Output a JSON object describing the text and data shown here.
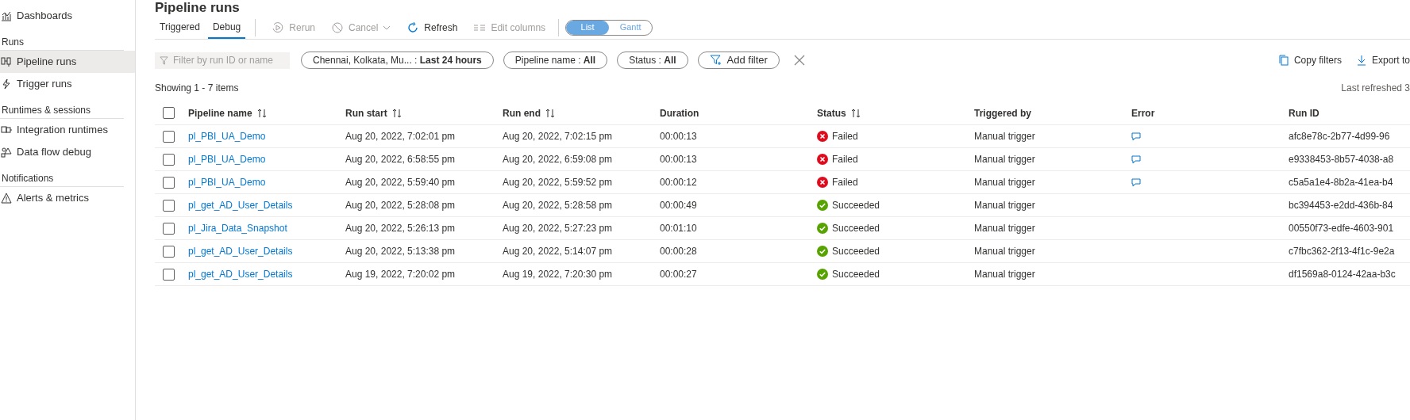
{
  "sidebar": {
    "sections": [
      {
        "items": [
          {
            "label": "Dashboards",
            "selected": false
          }
        ]
      },
      {
        "header": "Runs",
        "items": [
          {
            "label": "Pipeline runs",
            "selected": true
          },
          {
            "label": "Trigger runs",
            "selected": false
          }
        ]
      },
      {
        "header": "Runtimes & sessions",
        "items": [
          {
            "label": "Integration runtimes",
            "selected": false
          },
          {
            "label": "Data flow debug",
            "selected": false
          }
        ]
      },
      {
        "header": "Notifications",
        "items": [
          {
            "label": "Alerts & metrics",
            "selected": false
          }
        ]
      }
    ]
  },
  "page_title": "Pipeline runs",
  "tabs": [
    {
      "label": "Triggered",
      "selected": false
    },
    {
      "label": "Debug",
      "selected": true
    }
  ],
  "toolbar": [
    {
      "label": "Rerun",
      "disabled": true
    },
    {
      "label": "Cancel",
      "disabled": true,
      "dropdown": true
    },
    {
      "label": "Refresh",
      "disabled": false
    },
    {
      "label": "Edit columns",
      "disabled": true
    }
  ],
  "view_toggle": [
    {
      "label": "List",
      "selected": true
    },
    {
      "label": "Gantt",
      "selected": false
    }
  ],
  "search": {
    "placeholder": "Filter by run ID or name"
  },
  "filters": [
    {
      "label": "Chennai, Kolkata, Mu... :",
      "value": "Last 24 hours"
    },
    {
      "label": "Pipeline name :",
      "value": "All"
    },
    {
      "label": "Status :",
      "value": "All"
    }
  ],
  "add_filter": "Add filter",
  "actions": [
    {
      "label": "Copy filters"
    },
    {
      "label": "Export to"
    }
  ],
  "showing": "Showing 1 - 7 items",
  "last_refreshed": "Last refreshed 3",
  "table": {
    "select_all": {
      "checked": false
    },
    "columns": [
      {
        "label": "Pipeline name",
        "sortable": true
      },
      {
        "label": "Run start",
        "sortable": true
      },
      {
        "label": "Run end",
        "sortable": true
      },
      {
        "label": "Duration",
        "sortable": false
      },
      {
        "label": "Status",
        "sortable": true
      },
      {
        "label": "Triggered by",
        "sortable": false
      },
      {
        "label": "Error",
        "sortable": false
      },
      {
        "label": "Run ID",
        "sortable": false
      }
    ],
    "rows": [
      {
        "checked": false,
        "name": "pl_PBI_UA_Demo",
        "start": "Aug 20, 2022, 7:02:01 pm",
        "end": "Aug 20, 2022, 7:02:15 pm",
        "duration": "00:00:13",
        "status": {
          "kind": "failed",
          "label": "Failed"
        },
        "triggered_by": "Manual trigger",
        "error": true,
        "run_id": "afc8e78c-2b77-4d99-96"
      },
      {
        "checked": false,
        "name": "pl_PBI_UA_Demo",
        "start": "Aug 20, 2022, 6:58:55 pm",
        "end": "Aug 20, 2022, 6:59:08 pm",
        "duration": "00:00:13",
        "status": {
          "kind": "failed",
          "label": "Failed"
        },
        "triggered_by": "Manual trigger",
        "error": true,
        "run_id": "e9338453-8b57-4038-a8"
      },
      {
        "checked": false,
        "name": "pl_PBI_UA_Demo",
        "start": "Aug 20, 2022, 5:59:40 pm",
        "end": "Aug 20, 2022, 5:59:52 pm",
        "duration": "00:00:12",
        "status": {
          "kind": "failed",
          "label": "Failed"
        },
        "triggered_by": "Manual trigger",
        "error": true,
        "run_id": "c5a5a1e4-8b2a-41ea-b4"
      },
      {
        "checked": false,
        "name": "pl_get_AD_User_Details",
        "start": "Aug 20, 2022, 5:28:08 pm",
        "end": "Aug 20, 2022, 5:28:58 pm",
        "duration": "00:00:49",
        "status": {
          "kind": "succeeded",
          "label": "Succeeded"
        },
        "triggered_by": "Manual trigger",
        "error": false,
        "run_id": "bc394453-e2dd-436b-84"
      },
      {
        "checked": false,
        "name": "pl_Jira_Data_Snapshot",
        "start": "Aug 20, 2022, 5:26:13 pm",
        "end": "Aug 20, 2022, 5:27:23 pm",
        "duration": "00:01:10",
        "status": {
          "kind": "succeeded",
          "label": "Succeeded"
        },
        "triggered_by": "Manual trigger",
        "error": false,
        "run_id": "00550f73-edfe-4603-901"
      },
      {
        "checked": false,
        "name": "pl_get_AD_User_Details",
        "start": "Aug 20, 2022, 5:13:38 pm",
        "end": "Aug 20, 2022, 5:14:07 pm",
        "duration": "00:00:28",
        "status": {
          "kind": "succeeded",
          "label": "Succeeded"
        },
        "triggered_by": "Manual trigger",
        "error": false,
        "run_id": "c7fbc362-2f13-4f1c-9e2a"
      },
      {
        "checked": false,
        "name": "pl_get_AD_User_Details",
        "start": "Aug 19, 2022, 7:20:02 pm",
        "end": "Aug 19, 2022, 7:20:30 pm",
        "duration": "00:00:27",
        "status": {
          "kind": "succeeded",
          "label": "Succeeded"
        },
        "triggered_by": "Manual trigger",
        "error": false,
        "run_id": "df1569a8-0124-42aa-b3c"
      }
    ]
  }
}
